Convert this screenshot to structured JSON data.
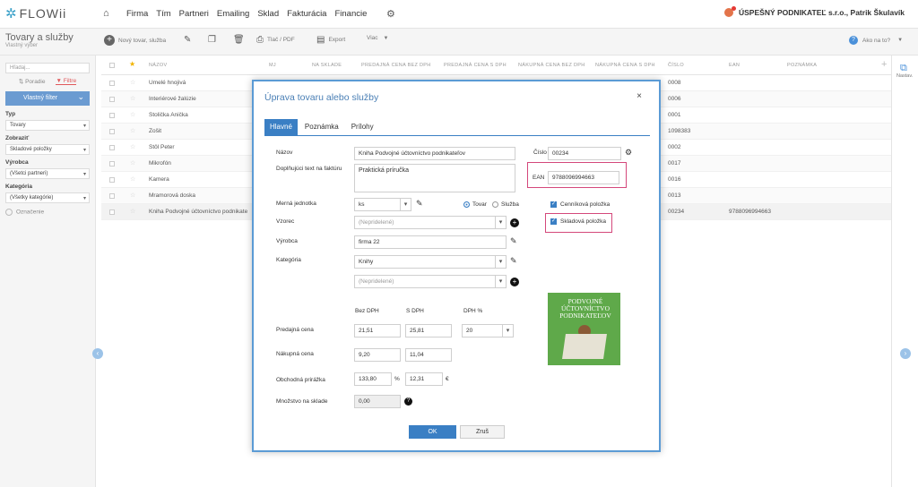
{
  "app": {
    "logo": "FLOWii",
    "company": "ÚSPEŠNÝ PODNIKATEĽ s.r.o., Patrik Škulavík"
  },
  "nav": [
    "Firma",
    "Tím",
    "Partneri",
    "Emailing",
    "Sklad",
    "Fakturácia",
    "Financie"
  ],
  "page": {
    "title": "Tovary a služby",
    "subtitle": "Vlastný výber"
  },
  "toolbar": {
    "new": "Nový tovar, služba",
    "print": "Tlač / PDF",
    "export": "Export",
    "more": "Viac",
    "help": "Ako na to?"
  },
  "sidebar": {
    "search_placeholder": "Hľadaj...",
    "tab_order": "Poradie",
    "tab_filter": "Filtre",
    "custom_filter": "Vlastný filter",
    "type_label": "Typ",
    "type_value": "Tovary",
    "show_label": "Zobraziť",
    "show_value": "Skladové položky",
    "maker_label": "Výrobca",
    "maker_value": "(Všetci partneri)",
    "category_label": "Kategória",
    "category_value": "(Všetky kategórie)",
    "marking": "Označenie"
  },
  "grid": {
    "headers": [
      "NÁZOV",
      "MJ",
      "NA SKLADE",
      "PREDAJNÁ CENA BEZ DPH",
      "PREDAJNÁ CENA S DPH",
      "NÁKUPNÁ CENA BEZ DPH",
      "NÁKUPNÁ CENA S DPH",
      "ČÍSLO",
      "EAN",
      "POZNÁMKA"
    ],
    "rows": [
      {
        "name": "Umelé hnojivá",
        "num": "0008",
        "ean": ""
      },
      {
        "name": "Interiérové žalúzie",
        "num": "0006",
        "ean": ""
      },
      {
        "name": "Stolička Anička",
        "num": "0001",
        "ean": ""
      },
      {
        "name": "Zošit",
        "num": "1098383",
        "ean": ""
      },
      {
        "name": "Stôl Peter",
        "num": "0002",
        "ean": ""
      },
      {
        "name": "Mikrofón",
        "num": "0017",
        "ean": ""
      },
      {
        "name": "Kamera",
        "num": "0016",
        "ean": ""
      },
      {
        "name": "Mramorová doska",
        "num": "0013",
        "ean": ""
      },
      {
        "name": "Kniha Podvojné účtovníctvo podnikate",
        "num": "00234",
        "ean": "9788096994663"
      }
    ]
  },
  "right_panel": {
    "settings": "Nastav."
  },
  "modal": {
    "title": "Úprava tovaru alebo služby",
    "tabs": [
      "Hlavné",
      "Poznámka",
      "Prílohy"
    ],
    "name_label": "Názov",
    "name_value": "Kniha Podvojné účtovníctvo podnikateľov",
    "extra_label": "Doplňujúci text na faktúru",
    "extra_value": "Praktická príručka",
    "number_label": "Číslo",
    "number_value": "00234",
    "ean_label": "EAN",
    "ean_value": "9788096994663",
    "unit_label": "Merná jednotka",
    "unit_value": "ks",
    "radio_goods": "Tovar",
    "radio_service": "Služba",
    "pricelist_item": "Cenníková položka",
    "stock_item": "Skladová položka",
    "template_label": "Vzorec",
    "template_value": "(Nepridelené)",
    "maker_label": "Výrobca",
    "maker_value": "firma 22",
    "category_label": "Kategória",
    "category_value": "Knihy",
    "category2_value": "(Nepridelené)",
    "col_without": "Bez DPH",
    "col_with": "S DPH",
    "col_vat": "DPH %",
    "sale_label": "Predajná cena",
    "sale_without": "21,51",
    "sale_with": "25,81",
    "vat_value": "20",
    "buy_label": "Nákupná cena",
    "buy_without": "9,20",
    "buy_with": "11,04",
    "margin_label": "Obchodná prirážka",
    "margin_pct": "133,80",
    "pct_sign": "%",
    "margin_eur": "12,31",
    "eur_sign": "€",
    "stock_label": "Množstvo na sklade",
    "stock_value": "0,00",
    "ok": "OK",
    "cancel": "Zruš",
    "book_title": "PODVOJNÉ ÚČTOVNÍCTVO PODNIKATEĽOV"
  }
}
